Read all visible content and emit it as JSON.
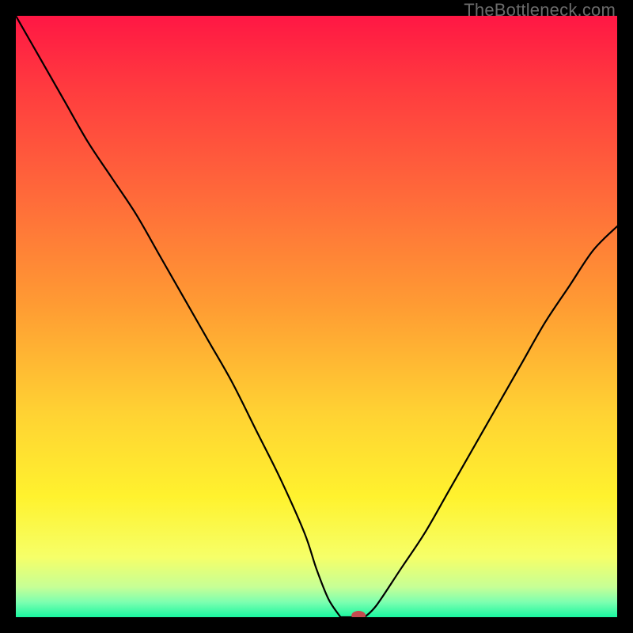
{
  "watermark": "TheBottleneck.com",
  "chart_data": {
    "type": "line",
    "title": "",
    "xlabel": "",
    "ylabel": "",
    "xlim": [
      0,
      100
    ],
    "ylim": [
      0,
      100
    ],
    "grid": false,
    "legend": false,
    "background_gradient": {
      "stops": [
        {
          "offset": 0.0,
          "color": "#ff1744"
        },
        {
          "offset": 0.12,
          "color": "#ff3b3f"
        },
        {
          "offset": 0.3,
          "color": "#ff6a3a"
        },
        {
          "offset": 0.48,
          "color": "#ff9b33"
        },
        {
          "offset": 0.66,
          "color": "#ffd233"
        },
        {
          "offset": 0.8,
          "color": "#fff22e"
        },
        {
          "offset": 0.9,
          "color": "#f6ff68"
        },
        {
          "offset": 0.95,
          "color": "#c6ff96"
        },
        {
          "offset": 0.975,
          "color": "#7dffb0"
        },
        {
          "offset": 1.0,
          "color": "#19f7a0"
        }
      ]
    },
    "series": [
      {
        "name": "left-branch",
        "x": [
          0,
          4,
          8,
          12,
          16,
          20,
          24,
          28,
          32,
          36,
          40,
          44,
          48,
          50,
          52,
          54
        ],
        "y": [
          100,
          93,
          86,
          79,
          73,
          67,
          60,
          53,
          46,
          39,
          31,
          23,
          14,
          8,
          3,
          0
        ]
      },
      {
        "name": "valley-flat",
        "x": [
          54,
          55,
          56,
          57,
          58
        ],
        "y": [
          0,
          0,
          0,
          0,
          0
        ]
      },
      {
        "name": "right-branch",
        "x": [
          58,
          60,
          64,
          68,
          72,
          76,
          80,
          84,
          88,
          92,
          96,
          100
        ],
        "y": [
          0,
          2,
          8,
          14,
          21,
          28,
          35,
          42,
          49,
          55,
          61,
          65
        ]
      }
    ],
    "marker": {
      "x": 57,
      "y": 0,
      "color": "#c44a4f",
      "rx": 9,
      "ry": 6
    }
  }
}
